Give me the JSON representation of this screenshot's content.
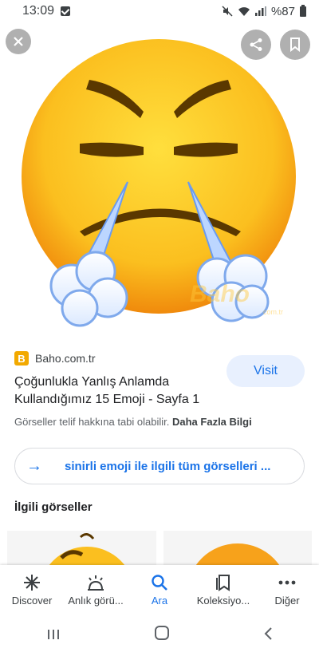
{
  "status_bar": {
    "time": "13:09",
    "battery": "%87"
  },
  "image_viewer": {
    "watermark": "Baho",
    "watermark_sub": "com.tr",
    "close_icon": "close-icon",
    "share_icon": "share-icon",
    "bookmark_icon": "bookmark-icon"
  },
  "result": {
    "source": "Baho.com.tr",
    "favicon_letter": "B",
    "title": "Çoğunlukla Yanlış Anlamda Kullandığımız 15 Emoji - Sayfa 1",
    "visit_label": "Visit",
    "copyright_text": "Görseller telif hakkına tabi olabilir.",
    "more_info_label": "Daha Fazla Bilgi"
  },
  "all_images": {
    "label": "sinirli emoji ile ilgili tüm görselleri ..."
  },
  "related": {
    "title": "İlgili görseller"
  },
  "bottom_nav": {
    "items": [
      {
        "label": "Discover",
        "icon": "asterisk-icon"
      },
      {
        "label": "Anlık görü...",
        "icon": "updates-icon"
      },
      {
        "label": "Ara",
        "icon": "search-icon"
      },
      {
        "label": "Koleksiyo...",
        "icon": "collections-icon"
      },
      {
        "label": "Diğer",
        "icon": "more-icon"
      }
    ],
    "active_index": 2
  },
  "colors": {
    "accent": "#1a73e8",
    "emoji_face": "#f7b500"
  }
}
